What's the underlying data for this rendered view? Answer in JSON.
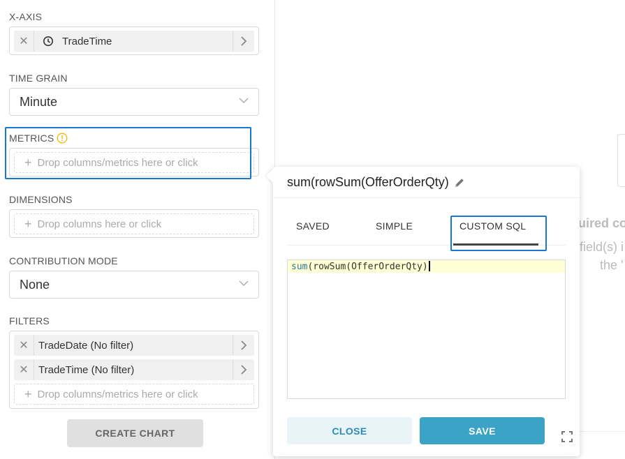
{
  "x_axis": {
    "label": "X-AXIS",
    "value": "TradeTime"
  },
  "time_grain": {
    "label": "TIME GRAIN",
    "value": "Minute"
  },
  "metrics": {
    "label": "METRICS",
    "placeholder": "Drop columns/metrics here or click"
  },
  "dimensions": {
    "label": "DIMENSIONS",
    "placeholder": "Drop columns here or click"
  },
  "contribution_mode": {
    "label": "CONTRIBUTION MODE",
    "value": "None"
  },
  "filters": {
    "label": "FILTERS",
    "items": [
      {
        "label": "TradeDate (No filter)"
      },
      {
        "label": "TradeTime (No filter)"
      }
    ],
    "placeholder": "Drop columns/metrics here or click"
  },
  "create_chart_label": "CREATE CHART",
  "background": {
    "fragment_1": "uired co",
    "fragment_2": "field(s) i",
    "fragment_3": "the '"
  },
  "popover": {
    "title": "sum(rowSum(OfferOrderQty)",
    "tabs": [
      {
        "label": "SAVED"
      },
      {
        "label": "SIMPLE"
      },
      {
        "label": "CUSTOM SQL",
        "active": true
      }
    ],
    "editor": {
      "fn": "sum",
      "rest": "(rowSum(OfferOrderQty)"
    },
    "close_label": "CLOSE",
    "save_label": "SAVE"
  },
  "colors": {
    "accent": "#3ba3c6",
    "highlight": "#1976d2",
    "warning": "#f2b90a"
  }
}
